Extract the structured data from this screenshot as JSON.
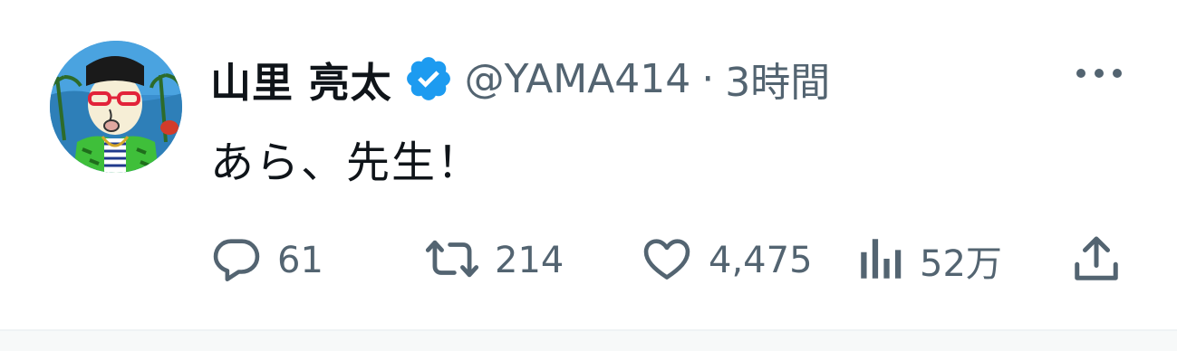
{
  "author": {
    "display_name": "山里 亮太",
    "handle": "@YAMA414",
    "separator": "·",
    "timestamp": "3時間",
    "verified": true
  },
  "tweet": {
    "text": "あら、先生！"
  },
  "actions": {
    "reply_count": "61",
    "retweet_count": "214",
    "like_count": "4,475",
    "views_count": "52万"
  },
  "colors": {
    "text_primary": "#0f1419",
    "text_secondary": "#536471",
    "verified_blue": "#1d9bf0"
  },
  "icons": {
    "more": "more-horizontal-icon",
    "reply": "comment-bubble-icon",
    "retweet": "retweet-arrows-icon",
    "like": "heart-icon",
    "views": "bar-chart-icon",
    "share": "share-upload-icon"
  }
}
